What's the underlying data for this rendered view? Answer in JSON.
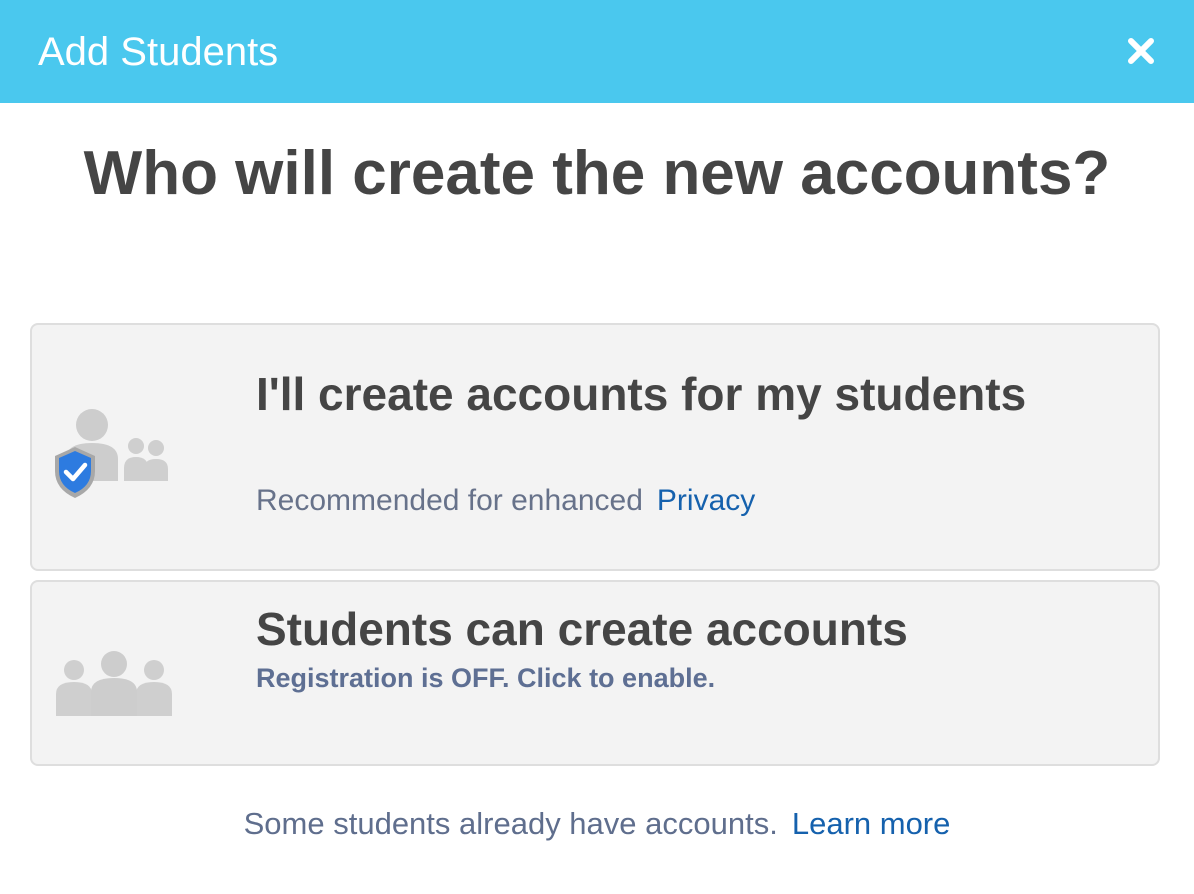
{
  "header": {
    "title": "Add Students",
    "close_icon": "close-icon"
  },
  "question": "Who will create the new accounts?",
  "options": [
    {
      "title": "I'll create accounts  for my students",
      "subtitle": "Recommended for enhanced",
      "link": "Privacy",
      "icon": "protected-students-icon"
    },
    {
      "title": "Students can create accounts",
      "subtitle": "Registration is OFF. Click to enable.",
      "icon": "students-group-icon"
    }
  ],
  "footer": {
    "text": "Some students already have accounts.",
    "link": "Learn more"
  },
  "colors": {
    "header_bg": "#4ac8ee",
    "heading": "#454545",
    "link": "#1561ad",
    "muted": "#67728a",
    "shield": "#2d7be0",
    "card_bg": "#f3f3f3"
  }
}
